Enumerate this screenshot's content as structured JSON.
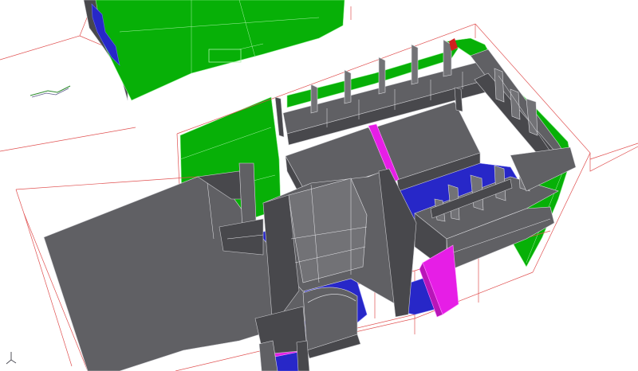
{
  "viewport": {
    "background": "#ffffff",
    "colors": {
      "structure": "#606064",
      "hull_plating": "#07b007",
      "deck_selected": "#2727c8",
      "highlight": "#e61ee6",
      "bounding_box": "#e05050",
      "marker": "#d21e1e"
    },
    "icons": {
      "axis_triad": "axis-triad-icon",
      "reference_marker": "reference-marker-icon"
    }
  }
}
